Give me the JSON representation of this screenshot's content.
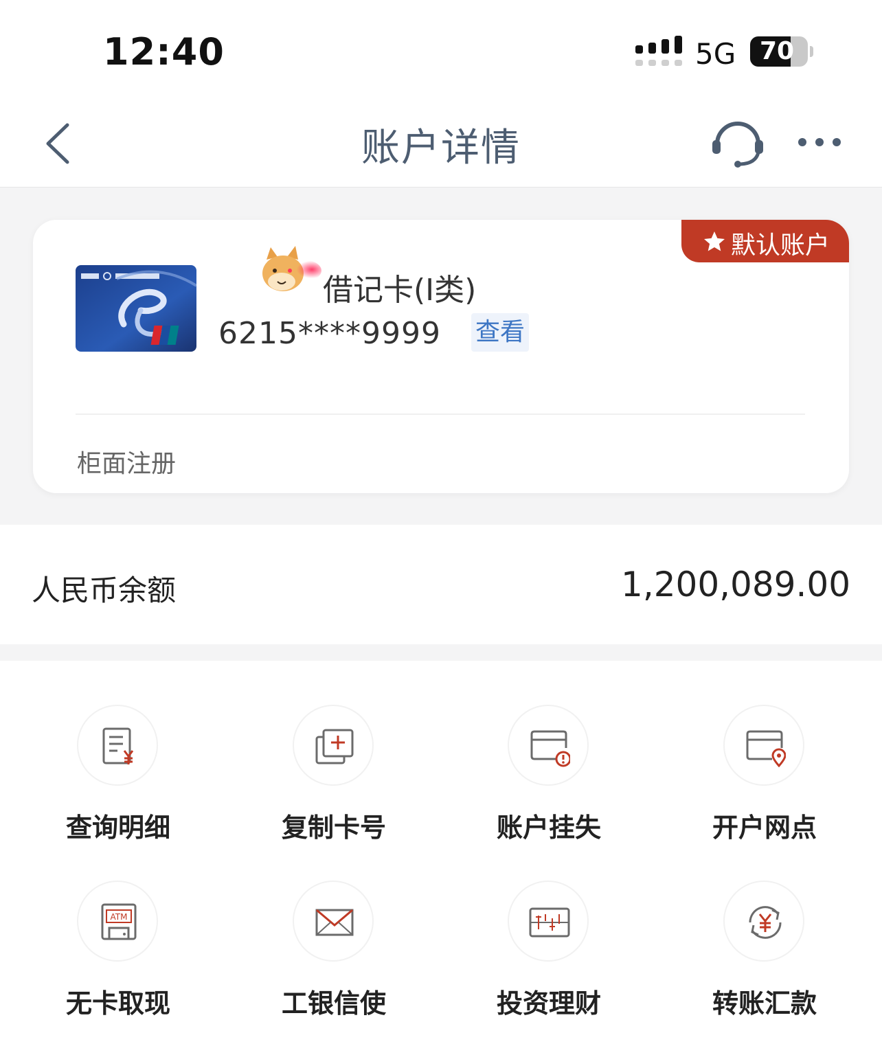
{
  "status_bar": {
    "time": "12:40",
    "network": "5G",
    "battery": "70",
    "battery_level": 0.7
  },
  "nav": {
    "title": "账户详情",
    "back_icon": "chevron-left-icon",
    "service_icon": "headset-icon",
    "more_icon": "ellipsis-icon"
  },
  "account_card": {
    "badge": "默认账户",
    "card_type": "借记卡(Ⅰ类)",
    "card_number": "6215****9999",
    "view_label": "查看",
    "registration": "柜面注册"
  },
  "balance": {
    "label": "人民币余额",
    "amount": "1,200,089.00"
  },
  "services": [
    {
      "label": "查询明细",
      "icon": "statement-yuan-icon"
    },
    {
      "label": "复制卡号",
      "icon": "copy-card-icon"
    },
    {
      "label": "账户挂失",
      "icon": "card-alert-icon"
    },
    {
      "label": "开户网点",
      "icon": "card-location-icon"
    },
    {
      "label": "无卡取现",
      "icon": "atm-icon"
    },
    {
      "label": "工银信使",
      "icon": "envelope-icon"
    },
    {
      "label": "投资理财",
      "icon": "investment-chart-icon"
    },
    {
      "label": "转账汇款",
      "icon": "transfer-yuan-icon"
    }
  ],
  "colors": {
    "accent_red": "#c03a25",
    "link_blue": "#3d76c4",
    "nav_title": "#4d5d71",
    "icon_gray": "#6b6b6b"
  }
}
